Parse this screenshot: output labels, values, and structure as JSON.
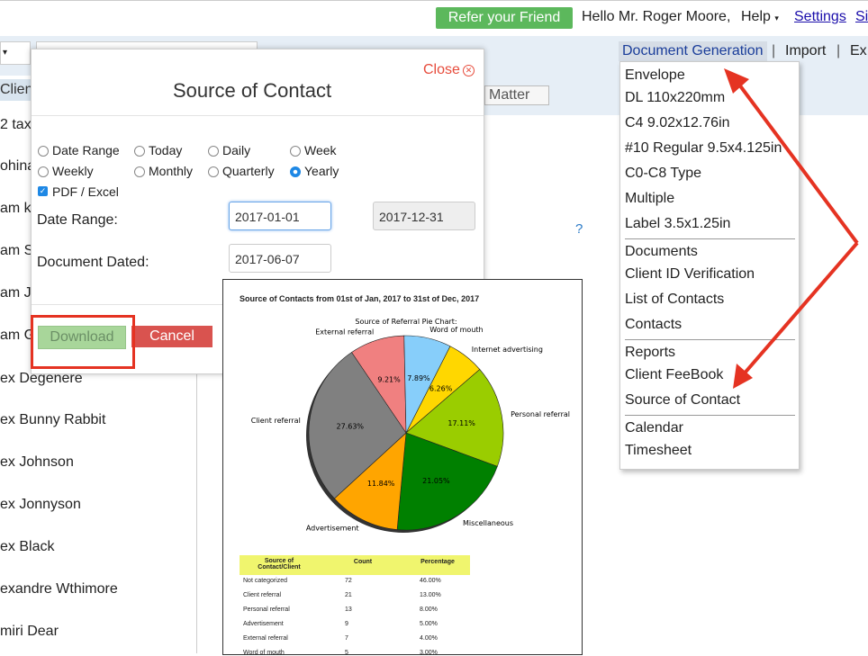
{
  "topbar": {
    "refer_label": "Refer your Friend",
    "greeting": "Hello Mr. Roger Moore,",
    "help_label": "Help",
    "settings_label": "Settings",
    "extra_label": "Si"
  },
  "menubar": {
    "document_generation": "Document Generation",
    "import": "Import",
    "export_partial": "Ex",
    "matter_label": "Matter",
    "client_label_partial": "Client"
  },
  "left_list": [
    "2 taxi",
    "ohina",
    "am k",
    "am S",
    "am J",
    "am G",
    "ex Degenere",
    "ex Bunny Rabbit",
    "ex Johnson",
    "ex Jonnyson",
    "ex Black",
    "exandre Wthimore",
    "miri Dear"
  ],
  "dropdown": {
    "items": [
      "Envelope",
      "DL 110x220mm",
      "C4 9.02x12.76in",
      "#10 Regular 9.5x4.125in",
      "C0-C8 Type",
      "Multiple",
      "Label 3.5x1.25in",
      "Documents",
      "Client ID Verification",
      "List of Contacts",
      "Contacts",
      "Reports",
      "Client FeeBook",
      "Source of Contact",
      "Calendar",
      "Timesheet"
    ]
  },
  "help_mark": "?",
  "modal": {
    "title": "Source of Contact",
    "close_label": "Close",
    "radios": [
      {
        "label": "Date Range",
        "checked": false
      },
      {
        "label": "Today",
        "checked": false
      },
      {
        "label": "Daily",
        "checked": false
      },
      {
        "label": "Week",
        "checked": false
      },
      {
        "label": "Weekly",
        "checked": false
      },
      {
        "label": "Monthly",
        "checked": false
      },
      {
        "label": "Quarterly",
        "checked": false
      },
      {
        "label": "Yearly",
        "checked": true
      }
    ],
    "pdf_excel_label": "PDF / Excel",
    "pdf_excel_checked": true,
    "date_range_label": "Date Range:",
    "date_from": "2017-01-01",
    "date_to": "2017-12-31",
    "document_dated_label": "Document Dated:",
    "document_dated": "2017-06-07",
    "download_label": "Download",
    "cancel_label": "Cancel"
  },
  "preview": {
    "title": "Source of Contacts from 01st of Jan, 2017 to 31st of Dec, 2017",
    "chart_title": "Source of Referral Pie Chart:",
    "table_headers": [
      "Source of Contact/Client",
      "Count",
      "Percentage"
    ],
    "table_rows": [
      [
        "Not categorized",
        "72",
        "46.00%"
      ],
      [
        "Client referral",
        "21",
        "13.00%"
      ],
      [
        "Personal referral",
        "13",
        "8.00%"
      ],
      [
        "Advertisement",
        "9",
        "5.00%"
      ],
      [
        "External referral",
        "7",
        "4.00%"
      ],
      [
        "Word of mouth",
        "5",
        "3.00%"
      ]
    ]
  },
  "chart_data": {
    "type": "pie",
    "title": "Source of Referral Pie Chart:",
    "slices": [
      {
        "label": "Internet advertising",
        "value": 6.26,
        "color": "#ffd700"
      },
      {
        "label": "Personal referral",
        "value": 17.11,
        "color": "#9acd00"
      },
      {
        "label": "Miscellaneous",
        "value": 21.05,
        "color": "#008000"
      },
      {
        "label": "Advertisement",
        "value": 11.84,
        "color": "#ffa500"
      },
      {
        "label": "Client referral",
        "value": 27.63,
        "color": "#808080"
      },
      {
        "label": "External referral",
        "value": 9.21,
        "color": "#f08080"
      },
      {
        "label": "Word of mouth",
        "value": 7.89,
        "color": "#87cefa"
      }
    ],
    "value_labels": [
      "6.26%",
      "17.11%",
      "21.05%",
      "11.84%",
      "27.63%",
      "9.21%",
      "7.89%"
    ]
  }
}
